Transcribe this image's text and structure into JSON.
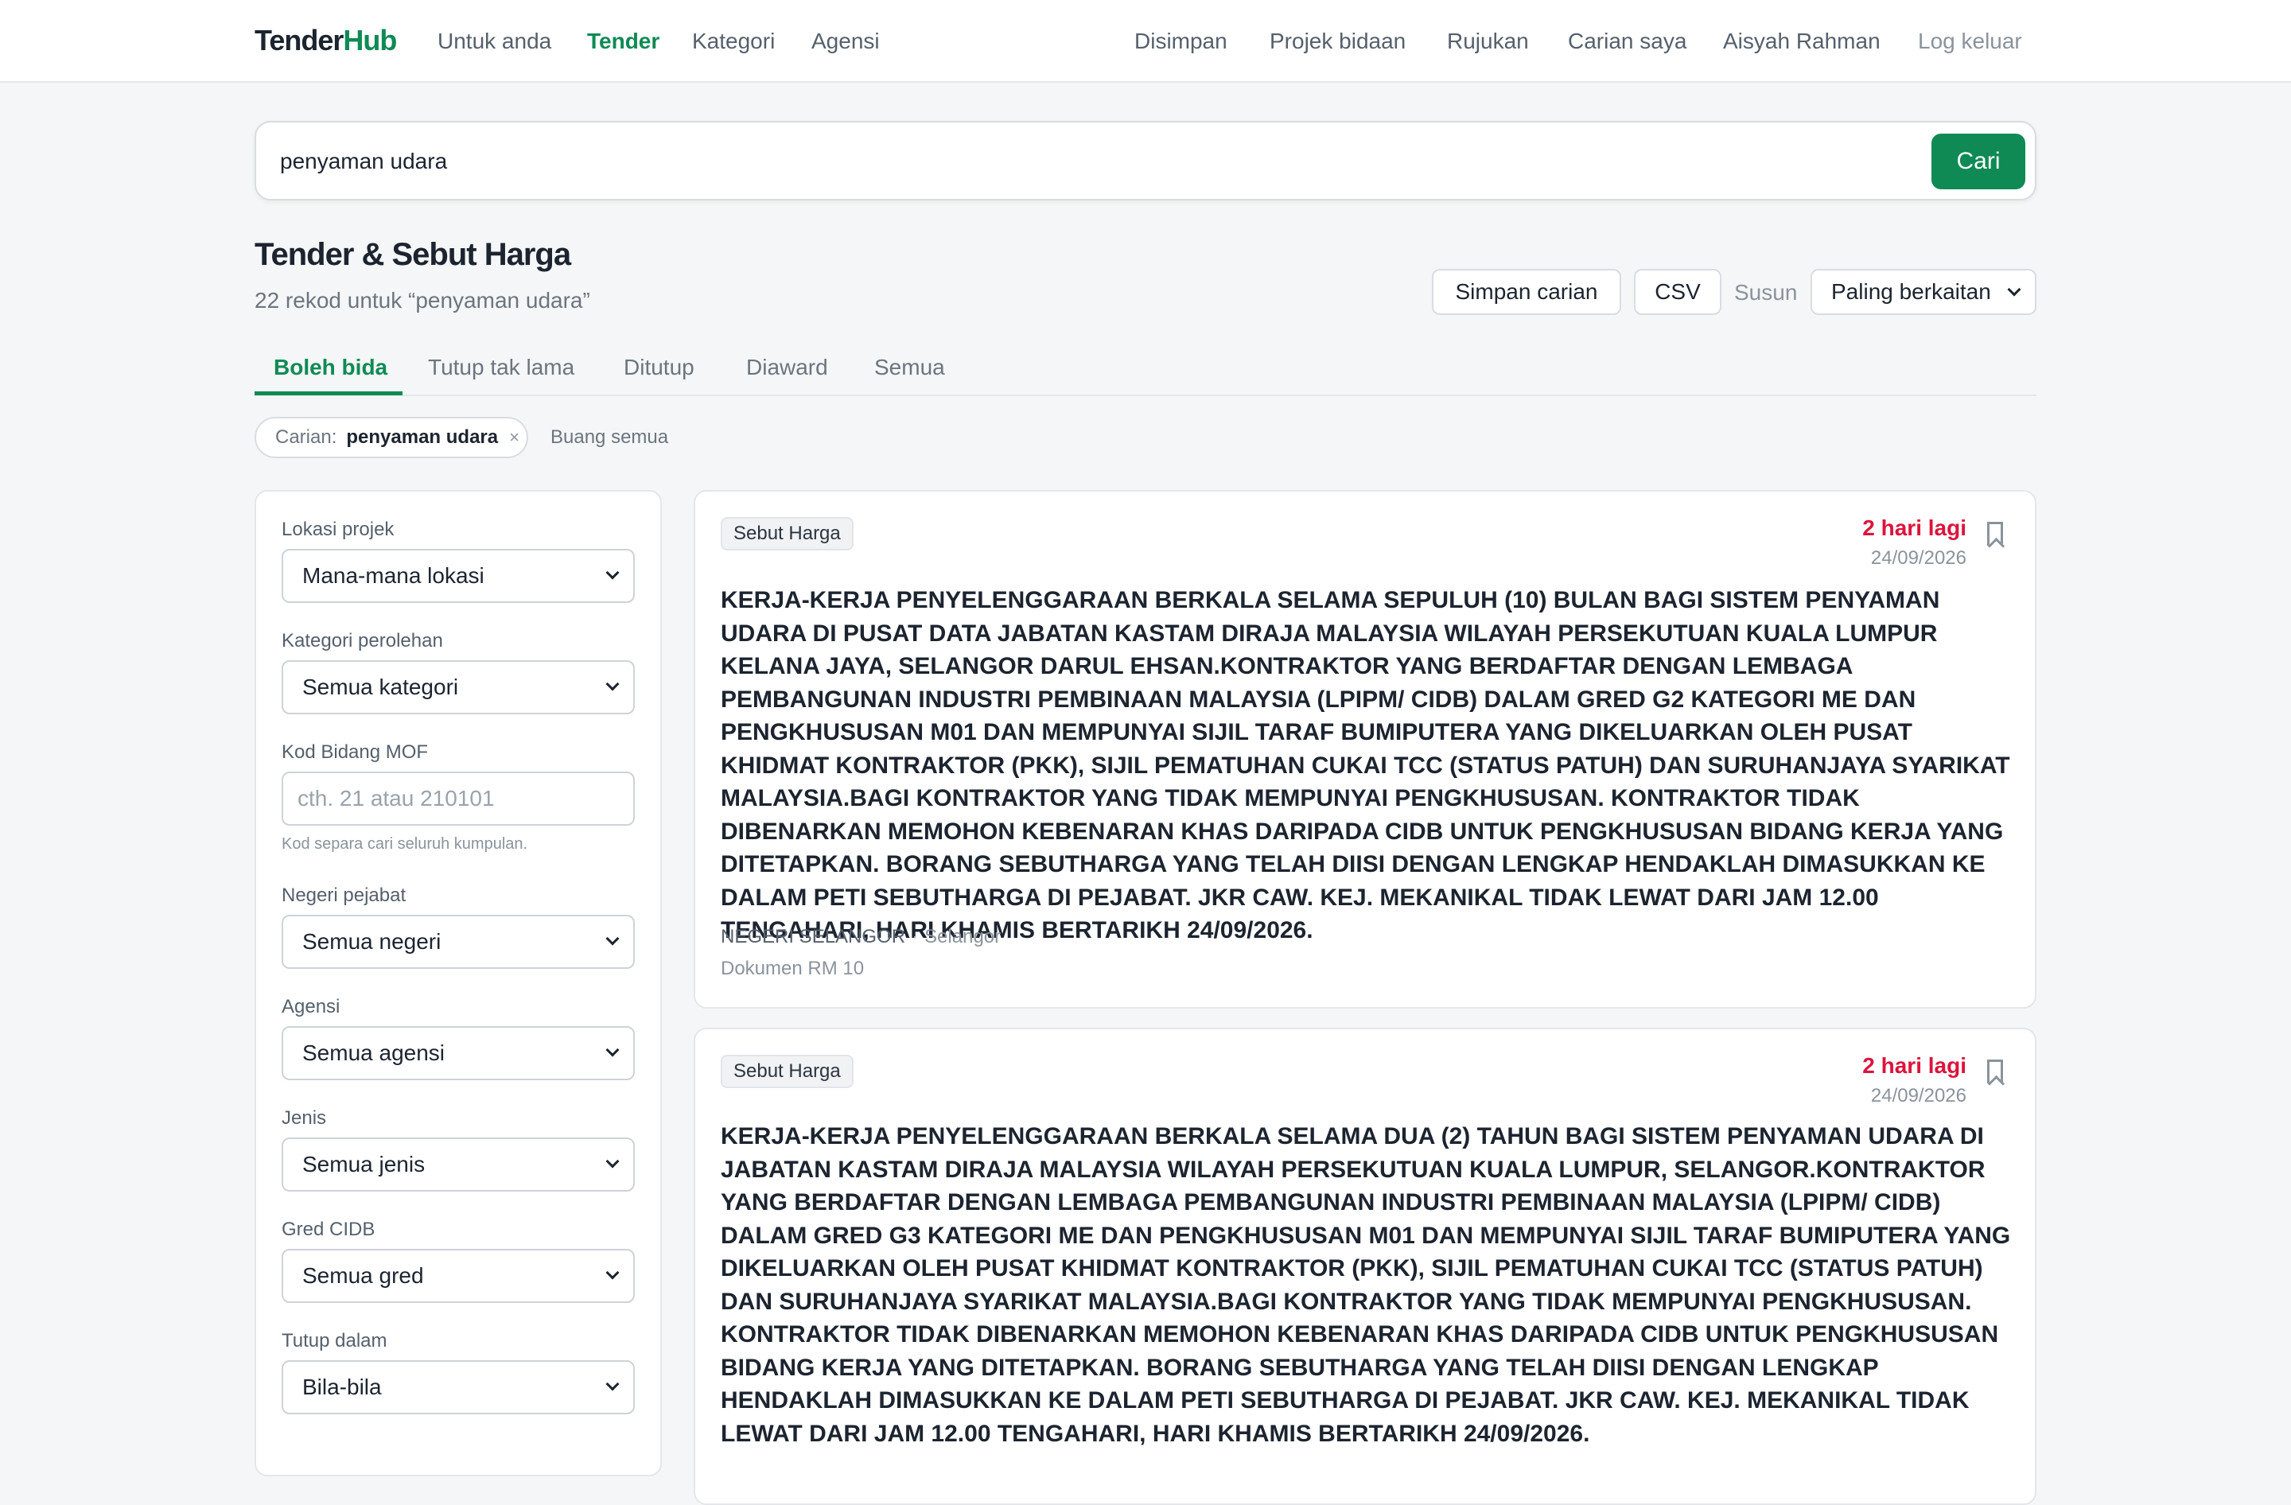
{
  "brand": {
    "part1": "Tender",
    "part2": "Hub"
  },
  "nav_left": [
    {
      "label": "Untuk anda"
    },
    {
      "label": "Tender"
    },
    {
      "label": "Kategori"
    },
    {
      "label": "Agensi"
    }
  ],
  "nav_right": [
    {
      "label": "Disimpan"
    },
    {
      "label": "Projek bidaan"
    },
    {
      "label": "Rujukan"
    },
    {
      "label": "Carian saya"
    },
    {
      "label": "Aisyah Rahman"
    },
    {
      "label": "Log keluar"
    }
  ],
  "search": {
    "value": "penyaman udara",
    "button": "Cari"
  },
  "heading": {
    "title": "Tender & Sebut Harga",
    "count": "22 rekod untuk “penyaman udara”"
  },
  "actions": {
    "save_search": "Simpan carian",
    "csv": "CSV",
    "sort_label": "Susun",
    "sort_value": "Paling berkaitan"
  },
  "tabs": [
    {
      "label": "Boleh bida",
      "active": true
    },
    {
      "label": "Tutup tak lama"
    },
    {
      "label": "Ditutup"
    },
    {
      "label": "Diaward"
    },
    {
      "label": "Semua"
    }
  ],
  "chip": {
    "label": "Carian:",
    "value": "penyaman udara",
    "remove": "×",
    "clear_all": "Buang semua"
  },
  "filters": {
    "location": {
      "label": "Lokasi projek",
      "value": "Mana-mana lokasi"
    },
    "category": {
      "label": "Kategori perolehan",
      "value": "Semua kategori"
    },
    "mof": {
      "label": "Kod Bidang MOF",
      "placeholder": "cth. 21 atau 210101",
      "hint": "Kod separa cari seluruh kumpulan."
    },
    "state": {
      "label": "Negeri pejabat",
      "value": "Semua negeri"
    },
    "agency": {
      "label": "Agensi",
      "value": "Semua agensi"
    },
    "type": {
      "label": "Jenis",
      "value": "Semua jenis"
    },
    "grade": {
      "label": "Gred CIDB",
      "value": "Semua gred"
    },
    "closing": {
      "label": "Tutup dalam",
      "value": "Bila-bila"
    }
  },
  "results": [
    {
      "badge": "Sebut Harga",
      "deadline": "2 hari lagi",
      "date": "24/09/2026",
      "title": "KERJA-KERJA PENYELENGGARAAN BERKALA SELAMA SEPULUH (10) BULAN BAGI SISTEM PENYAMAN UDARA DI PUSAT DATA JABATAN KASTAM DIRAJA MALAYSIA WILAYAH PERSEKUTUAN KUALA LUMPUR KELANA JAYA, SELANGOR DARUL EHSAN.KONTRAKTOR YANG BERDAFTAR DENGAN LEMBAGA PEMBANGUNAN INDUSTRI PEMBINAAN MALAYSIA (LPIPM/ CIDB) DALAM GRED G2 KATEGORI ME DAN PENGKHUSUSAN M01 DAN MEMPUNYAI SIJIL TARAF BUMIPUTERA YANG DIKELUARKAN OLEH PUSAT KHIDMAT KONTRAKTOR (PKK), SIJIL PEMATUHAN CUKAI TCC (STATUS PATUH) DAN SURUHANJAYA SYARIKAT MALAYSIA.BAGI KONTRAKTOR YANG TIDAK MEMPUNYAI PENGKHUSUSAN. KONTRAKTOR TIDAK DIBENARKAN MEMOHON KEBENARAN KHAS DARIPADA CIDB UNTUK PENGKHUSUSAN BIDANG KERJA YANG DITETAPKAN. BORANG SEBUTHARGA YANG TELAH DIISI DENGAN LENGKAP HENDAKLAH DIMASUKKAN KE DALAM PETI SEBUTHARGA DI PEJABAT. JKR CAW. KEJ. MEKANIKAL TIDAK LEWAT DARI JAM 12.00 TENGAHARI, HARI KHAMIS BERTARIKH 24/09/2026.",
      "agency": "NEGERI SELANGOR",
      "sep": "·",
      "state": "Selangor",
      "doc": "Dokumen RM 10"
    },
    {
      "badge": "Sebut Harga",
      "deadline": "2 hari lagi",
      "date": "24/09/2026",
      "title": "KERJA-KERJA PENYELENGGARAAN BERKALA SELAMA DUA (2) TAHUN BAGI SISTEM PENYAMAN UDARA DI JABATAN KASTAM DIRAJA MALAYSIA WILAYAH PERSEKUTUAN KUALA LUMPUR, SELANGOR.KONTRAKTOR YANG BERDAFTAR DENGAN LEMBAGA PEMBANGUNAN INDUSTRI PEMBINAAN MALAYSIA (LPIPM/ CIDB) DALAM GRED G3 KATEGORI ME DAN PENGKHUSUSAN M01 DAN MEMPUNYAI SIJIL TARAF BUMIPUTERA YANG DIKELUARKAN OLEH PUSAT KHIDMAT KONTRAKTOR (PKK), SIJIL PEMATUHAN CUKAI TCC (STATUS PATUH) DAN SURUHANJAYA SYARIKAT MALAYSIA.BAGI KONTRAKTOR YANG TIDAK MEMPUNYAI PENGKHUSUSAN. KONTRAKTOR TIDAK DIBENARKAN MEMOHON KEBENARAN KHAS DARIPADA CIDB UNTUK PENGKHUSUSAN BIDANG KERJA YANG DITETAPKAN. BORANG SEBUTHARGA YANG TELAH DIISI DENGAN LENGKAP HENDAKLAH DIMASUKKAN KE DALAM PETI SEBUTHARGA DI PEJABAT. JKR CAW. KEJ. MEKANIKAL TIDAK LEWAT DARI JAM 12.00 TENGAHARI, HARI KHAMIS BERTARIKH 24/09/2026."
    }
  ],
  "colors": {
    "accent": "#0f8a54",
    "deadline": "#dc143c",
    "background": "#f5f6f7"
  }
}
